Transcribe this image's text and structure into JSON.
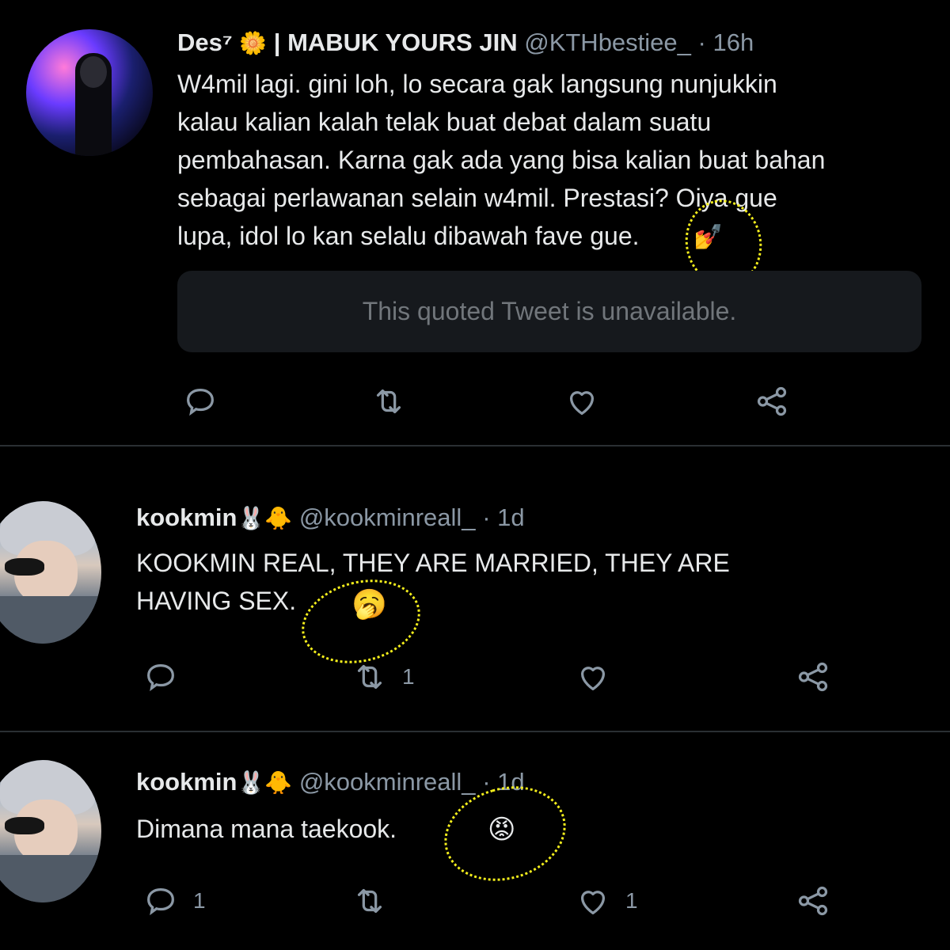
{
  "tweets": [
    {
      "name": "Des⁷",
      "name_emoji": "🌼",
      "name_suffix": " | MABUK YOURS JIN",
      "handle": "@KTHbestiee_",
      "time": "16h",
      "text": "W4mil lagi. gini loh, lo secara gak langsung nunjukkin\nkalau kalian kalah telak buat debat dalam suatu\npembahasan. Karna gak ada yang bisa kalian buat bahan\nsebagai perlawanan selain w4mil. Prestasi? Oiya gue\nlupa, idol lo kan selalu dibawah fave gue.",
      "text_emoji": "💅",
      "quote": "This quoted Tweet is unavailable.",
      "reply_count": "",
      "retweet_count": "",
      "like_count": ""
    },
    {
      "name": "kookmin",
      "name_emoji": "🐰🐥",
      "handle": "@kookminreall_",
      "time": "1d",
      "text": "KOOKMIN REAL, THEY ARE MARRIED, THEY ARE\nHAVING SEX.",
      "text_emoji": "🥱",
      "reply_count": "",
      "retweet_count": "1",
      "like_count": ""
    },
    {
      "name": "kookmin",
      "name_emoji": "🐰🐥",
      "handle": "@kookminreall_",
      "time": "1d",
      "text": "Dimana mana taekook.",
      "text_emoji": "😡",
      "reply_count": "1",
      "retweet_count": "",
      "like_count": "1"
    }
  ],
  "separator": "·",
  "icons": [
    "reply-icon",
    "retweet-icon",
    "like-icon",
    "share-icon"
  ],
  "colors": {
    "background": "#000000",
    "text": "#e7e9ea",
    "muted": "#8b98a5",
    "annotation": "#f5ef1c"
  }
}
